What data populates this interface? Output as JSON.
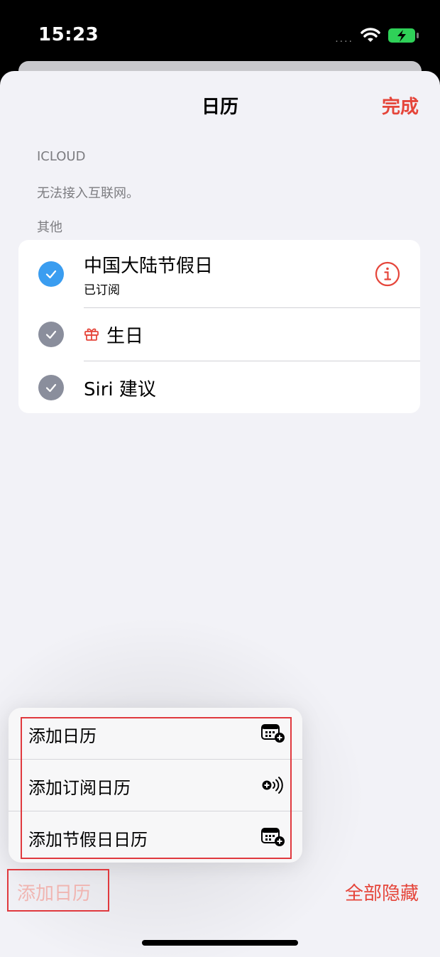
{
  "status_bar": {
    "time": "15:23",
    "signal": "....",
    "battery_charging": true
  },
  "header": {
    "title": "日历",
    "done_label": "完成"
  },
  "sections": {
    "icloud": {
      "header": "ICLOUD",
      "note": "无法接入互联网。"
    },
    "other": {
      "header": "其他"
    }
  },
  "calendars": [
    {
      "title": "中国大陆节假日",
      "subtitle": "已订阅",
      "checked": true,
      "color": "#3a9df0",
      "has_info": true
    },
    {
      "title": "生日",
      "checked": true,
      "color": "#8a8e9c",
      "icon": "gift-icon",
      "icon_color": "#e5453a"
    },
    {
      "title": "Siri 建议",
      "checked": true,
      "color": "#8a8e9c"
    }
  ],
  "menu": {
    "items": [
      {
        "label": "添加日历",
        "icon": "calendar-add-icon"
      },
      {
        "label": "添加订阅日历",
        "icon": "subscribe-add-icon"
      },
      {
        "label": "添加节假日日历",
        "icon": "calendar-add-icon"
      }
    ]
  },
  "toolbar": {
    "add_label": "添加日历",
    "hide_all_label": "全部隐藏"
  },
  "colors": {
    "accent": "#e5453a",
    "annotation": "#e0393e"
  }
}
